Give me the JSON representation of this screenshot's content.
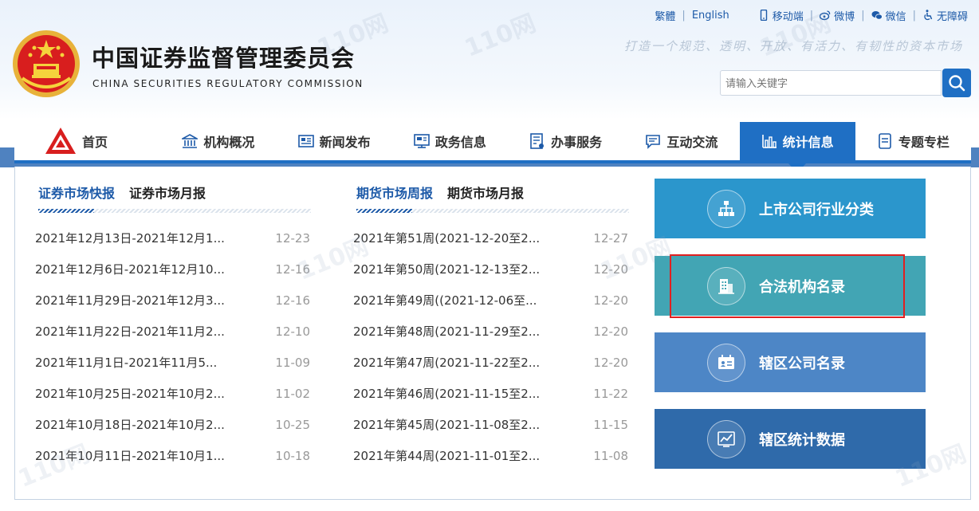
{
  "header": {
    "title_cn": "中国证券监督管理委员会",
    "title_en": "CHINA SECURITIES REGULATORY COMMISSION",
    "slogan": "打造一个规范、透明、开放、有活力、有韧性的资本市场",
    "toplinks": {
      "traditional": "繁體",
      "english": "English",
      "mobile": "移动端",
      "weibo": "微博",
      "wechat": "微信",
      "accessibility": "无障碍"
    },
    "search": {
      "placeholder": "请输入关键字"
    }
  },
  "nav": {
    "items": [
      {
        "label": "首页",
        "icon": "home-logo-icon"
      },
      {
        "label": "机构概况",
        "icon": "institution-icon"
      },
      {
        "label": "新闻发布",
        "icon": "news-icon"
      },
      {
        "label": "政务信息",
        "icon": "gov-info-icon"
      },
      {
        "label": "办事服务",
        "icon": "service-icon"
      },
      {
        "label": "互动交流",
        "icon": "chat-icon"
      },
      {
        "label": "统计信息",
        "icon": "chart-icon",
        "active": true
      },
      {
        "label": "专题专栏",
        "icon": "topic-icon"
      }
    ]
  },
  "left_panel": {
    "tabs": [
      "证券市场快报",
      "证券市场月报"
    ],
    "rows": [
      {
        "title": "2021年12月13日-2021年12月1...",
        "date": "12-23"
      },
      {
        "title": "2021年12月6日-2021年12月10...",
        "date": "12-16"
      },
      {
        "title": "2021年11月29日-2021年12月3...",
        "date": "12-16"
      },
      {
        "title": "2021年11月22日-2021年11月2...",
        "date": "12-10"
      },
      {
        "title": "2021年11月1日-2021年11月5...",
        "date": "11-09"
      },
      {
        "title": "2021年10月25日-2021年10月2...",
        "date": "11-02"
      },
      {
        "title": "2021年10月18日-2021年10月2...",
        "date": "10-25"
      },
      {
        "title": "2021年10月11日-2021年10月1...",
        "date": "10-18"
      }
    ]
  },
  "middle_panel": {
    "tabs": [
      "期货市场周报",
      "期货市场月报"
    ],
    "rows": [
      {
        "title": "2021年第51周(2021-12-20至2...",
        "date": "12-27"
      },
      {
        "title": "2021年第50周(2021-12-13至2...",
        "date": "12-20"
      },
      {
        "title": "2021年第49周((2021-12-06至...",
        "date": "12-20"
      },
      {
        "title": "2021年第48周(2021-11-29至2...",
        "date": "12-20"
      },
      {
        "title": "2021年第47周(2021-11-22至2...",
        "date": "12-20"
      },
      {
        "title": "2021年第46周(2021-11-15至2...",
        "date": "11-22"
      },
      {
        "title": "2021年第45周(2021-11-08至2...",
        "date": "11-15"
      },
      {
        "title": "2021年第44周(2021-11-01至2...",
        "date": "11-08"
      }
    ]
  },
  "cards": [
    {
      "label": "上市公司行业分类",
      "icon": "org-chart-icon",
      "color": "#2b96cc"
    },
    {
      "label": "合法机构名录",
      "icon": "building-icon",
      "color": "#42a5b4"
    },
    {
      "label": "辖区公司名录",
      "icon": "id-card-icon",
      "color": "#4d86c6"
    },
    {
      "label": "辖区统计数据",
      "icon": "line-chart-icon",
      "color": "#2f6aaa"
    }
  ],
  "colors": {
    "primary": "#1f6fc4",
    "band": "#4f82c0",
    "highlight_border": "#e02020"
  }
}
